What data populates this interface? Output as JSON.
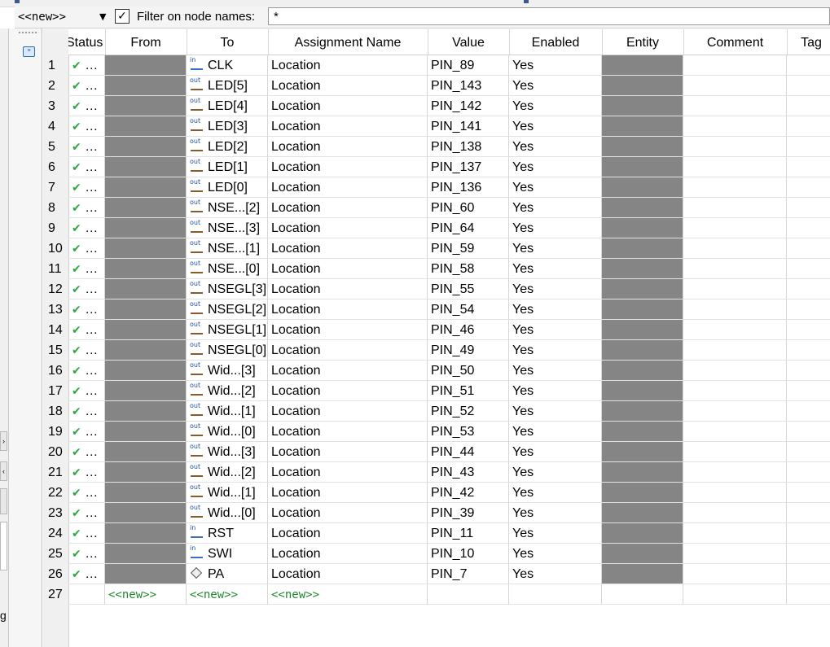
{
  "toolbar": {
    "new_dropdown": "<<new>>",
    "filter_checkbox_checked": true,
    "filter_label": "Filter on node names:",
    "filter_value": "*"
  },
  "left_edge": {
    "glyphs": [
      "›",
      "‹",
      "g"
    ]
  },
  "table": {
    "columns": [
      "Status",
      "From",
      "To",
      "Assignment Name",
      "Value",
      "Enabled",
      "Entity",
      "Comment",
      "Tag"
    ],
    "rows": [
      {
        "num": "1",
        "status": "…",
        "to": "CLK",
        "dir": "in",
        "assign": "Location",
        "value": "PIN_89",
        "enabled": "Yes"
      },
      {
        "num": "2",
        "status": "…",
        "to": "LED[5]",
        "dir": "out",
        "assign": "Location",
        "value": "PIN_143",
        "enabled": "Yes"
      },
      {
        "num": "3",
        "status": "…",
        "to": "LED[4]",
        "dir": "out",
        "assign": "Location",
        "value": "PIN_142",
        "enabled": "Yes"
      },
      {
        "num": "4",
        "status": "…",
        "to": "LED[3]",
        "dir": "out",
        "assign": "Location",
        "value": "PIN_141",
        "enabled": "Yes"
      },
      {
        "num": "5",
        "status": "…",
        "to": "LED[2]",
        "dir": "out",
        "assign": "Location",
        "value": "PIN_138",
        "enabled": "Yes"
      },
      {
        "num": "6",
        "status": "…",
        "to": "LED[1]",
        "dir": "out",
        "assign": "Location",
        "value": "PIN_137",
        "enabled": "Yes"
      },
      {
        "num": "7",
        "status": "…",
        "to": "LED[0]",
        "dir": "out",
        "assign": "Location",
        "value": "PIN_136",
        "enabled": "Yes"
      },
      {
        "num": "8",
        "status": "…",
        "to": "NSE...[2]",
        "dir": "out",
        "assign": "Location",
        "value": "PIN_60",
        "enabled": "Yes"
      },
      {
        "num": "9",
        "status": "…",
        "to": "NSE...[3]",
        "dir": "out",
        "assign": "Location",
        "value": "PIN_64",
        "enabled": "Yes"
      },
      {
        "num": "10",
        "status": "…",
        "to": "NSE...[1]",
        "dir": "out",
        "assign": "Location",
        "value": "PIN_59",
        "enabled": "Yes"
      },
      {
        "num": "11",
        "status": "…",
        "to": "NSE...[0]",
        "dir": "out",
        "assign": "Location",
        "value": "PIN_58",
        "enabled": "Yes"
      },
      {
        "num": "12",
        "status": "…",
        "to": "NSEGL[3]",
        "dir": "out",
        "assign": "Location",
        "value": "PIN_55",
        "enabled": "Yes"
      },
      {
        "num": "13",
        "status": "…",
        "to": "NSEGL[2]",
        "dir": "out",
        "assign": "Location",
        "value": "PIN_54",
        "enabled": "Yes"
      },
      {
        "num": "14",
        "status": "…",
        "to": "NSEGL[1]",
        "dir": "out",
        "assign": "Location",
        "value": "PIN_46",
        "enabled": "Yes"
      },
      {
        "num": "15",
        "status": "…",
        "to": "NSEGL[0]",
        "dir": "out",
        "assign": "Location",
        "value": "PIN_49",
        "enabled": "Yes"
      },
      {
        "num": "16",
        "status": "…",
        "to": "Wid...[3]",
        "dir": "out",
        "assign": "Location",
        "value": "PIN_50",
        "enabled": "Yes"
      },
      {
        "num": "17",
        "status": "…",
        "to": "Wid...[2]",
        "dir": "out",
        "assign": "Location",
        "value": "PIN_51",
        "enabled": "Yes"
      },
      {
        "num": "18",
        "status": "…",
        "to": "Wid...[1]",
        "dir": "out",
        "assign": "Location",
        "value": "PIN_52",
        "enabled": "Yes"
      },
      {
        "num": "19",
        "status": "…",
        "to": "Wid...[0]",
        "dir": "out",
        "assign": "Location",
        "value": "PIN_53",
        "enabled": "Yes"
      },
      {
        "num": "20",
        "status": "…",
        "to": "Wid...[3]",
        "dir": "out",
        "assign": "Location",
        "value": "PIN_44",
        "enabled": "Yes"
      },
      {
        "num": "21",
        "status": "…",
        "to": "Wid...[2]",
        "dir": "out",
        "assign": "Location",
        "value": "PIN_43",
        "enabled": "Yes"
      },
      {
        "num": "22",
        "status": "…",
        "to": "Wid...[1]",
        "dir": "out",
        "assign": "Location",
        "value": "PIN_42",
        "enabled": "Yes"
      },
      {
        "num": "23",
        "status": "…",
        "to": "Wid...[0]",
        "dir": "out",
        "assign": "Location",
        "value": "PIN_39",
        "enabled": "Yes"
      },
      {
        "num": "24",
        "status": "…",
        "to": "RST",
        "dir": "in",
        "assign": "Location",
        "value": "PIN_11",
        "enabled": "Yes"
      },
      {
        "num": "25",
        "status": "…",
        "to": "SWI",
        "dir": "in",
        "assign": "Location",
        "value": "PIN_10",
        "enabled": "Yes"
      },
      {
        "num": "26",
        "status": "…",
        "to": "PA",
        "dir": "bidir",
        "assign": "Location",
        "value": "PIN_7",
        "enabled": "Yes"
      }
    ],
    "new_row": {
      "num": "27",
      "from": "<<new>>",
      "to": "<<new>>",
      "assign": "<<new>>"
    }
  },
  "colors": {
    "check_green": "#2ea83e",
    "new_green": "#1f8a2e",
    "redacted_gray": "#858585"
  }
}
